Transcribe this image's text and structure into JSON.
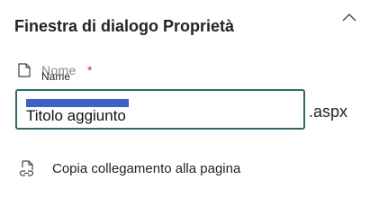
{
  "panel": {
    "title": "Finestra di dialogo Proprietà",
    "collapse_icon": "chevron-up-icon"
  },
  "name_field": {
    "label": "Name",
    "ghost_label": "Nome",
    "required_marker": "*",
    "value": "Titolo aggiunto",
    "suffix": ".aspx",
    "icon": "page-icon"
  },
  "copy_link": {
    "label": "Copia collegamento alla pagina",
    "icon": "link-page-icon"
  },
  "colors": {
    "input_border": "#2f6a6a",
    "selection": "#3b63c8",
    "required": "#c4314b"
  }
}
